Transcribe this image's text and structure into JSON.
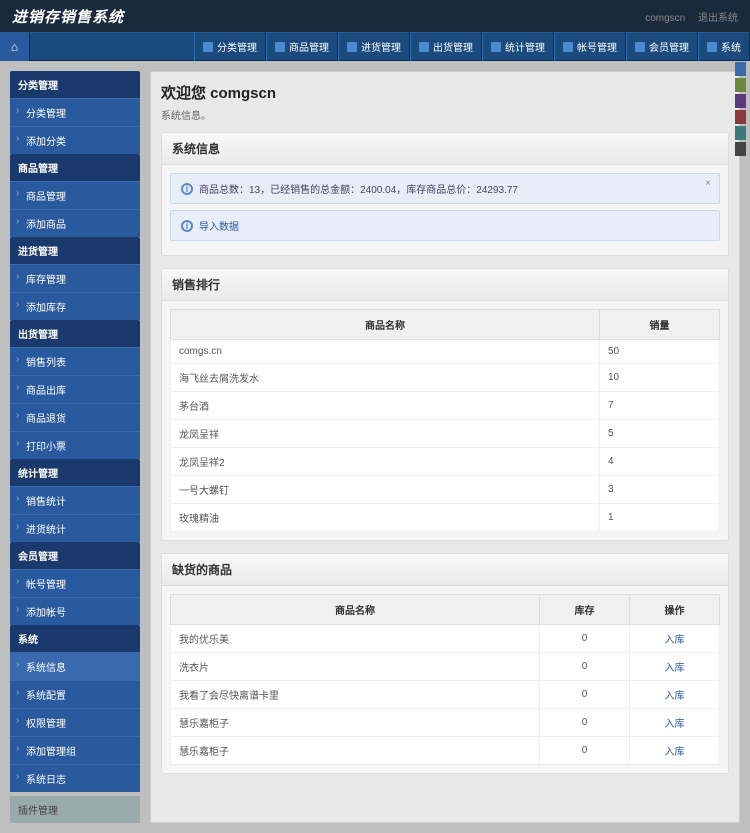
{
  "top": {
    "title": "进销存销售系统",
    "user": "comgscn",
    "logout": "退出系统"
  },
  "nav": [
    {
      "l": "分类管理"
    },
    {
      "l": "商品管理"
    },
    {
      "l": "进货管理"
    },
    {
      "l": "出货管理"
    },
    {
      "l": "统计管理"
    },
    {
      "l": "帐号管理"
    },
    {
      "l": "会员管理"
    },
    {
      "l": "系统"
    }
  ],
  "side": [
    {
      "h": "分类管理",
      "items": [
        "分类管理",
        "添加分类"
      ]
    },
    {
      "h": "商品管理",
      "items": [
        "商品管理",
        "添加商品"
      ]
    },
    {
      "h": "进货管理",
      "items": [
        "库存管理",
        "添加库存"
      ]
    },
    {
      "h": "出货管理",
      "items": [
        "销售列表",
        "商品出库",
        "商品退货",
        "打印小票"
      ]
    },
    {
      "h": "统计管理",
      "items": [
        "销售统计",
        "进货统计"
      ]
    },
    {
      "h": "会员管理",
      "items": [
        "帐号管理",
        "添加帐号"
      ]
    },
    {
      "h": "系统",
      "items": [
        "系统信息",
        "系统配置",
        "权限管理",
        "添加管理组",
        "系统日志"
      ]
    }
  ],
  "side_foot": "插件管理",
  "welcome": "欢迎您 comgscn",
  "sub": "系统信息。",
  "p1": {
    "title": "系统信息",
    "msg": "商品总数：13，已经销售的总金额：2400.04，库存商品总价：24293.77",
    "import": "导入数据"
  },
  "p2": {
    "title": "销售排行",
    "cols": [
      "商品名称",
      "销量"
    ],
    "rows": [
      {
        "n": "comgs.cn",
        "q": "50"
      },
      {
        "n": "海飞丝去屑洗发水",
        "q": "10"
      },
      {
        "n": "茅台酒",
        "q": "7"
      },
      {
        "n": "龙凤呈祥",
        "q": "5"
      },
      {
        "n": "龙凤呈祥2",
        "q": "4"
      },
      {
        "n": "一号大螺钉",
        "q": "3"
      },
      {
        "n": "玫瑰精油",
        "q": "1"
      }
    ]
  },
  "p3": {
    "title": "缺货的商品",
    "cols": [
      "商品名称",
      "库存",
      "操作"
    ],
    "rows": [
      {
        "n": "我的优乐美",
        "s": "0",
        "a": "入库"
      },
      {
        "n": "洗衣片",
        "s": "0",
        "a": "入库"
      },
      {
        "n": "我看了会尽快离谱卡里",
        "s": "0",
        "a": "入库"
      },
      {
        "n": "慧乐嘉柜子",
        "s": "0",
        "a": "入库"
      },
      {
        "n": "慧乐嘉柜子",
        "s": "0",
        "a": "入库"
      }
    ]
  },
  "tabs": [
    "#3a6aae",
    "#6a8a3a",
    "#5a3a7e",
    "#8a3a3a",
    "#3a7a7a",
    "#444"
  ]
}
